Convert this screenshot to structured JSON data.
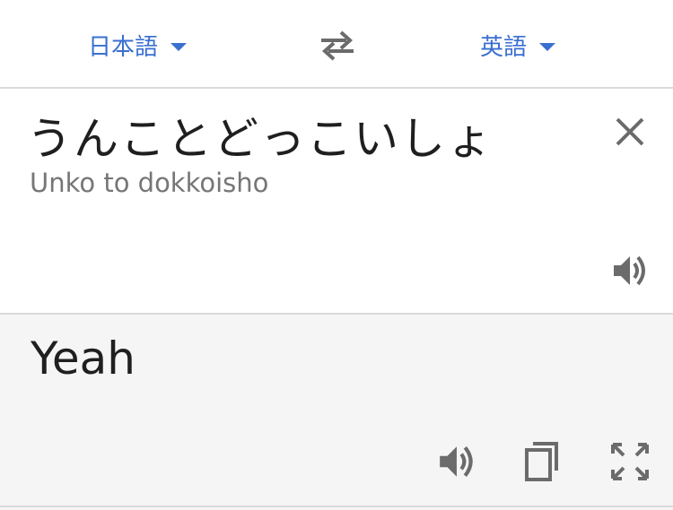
{
  "language_bar": {
    "source_language": "日本語",
    "target_language": "英語",
    "swap_icon": "swap-arrows-icon",
    "dropdown_icon": "caret-down-icon",
    "accent_color": "#3a6fd0"
  },
  "input": {
    "source_text": "うんことどっこいしょ",
    "romanization": "Unko to dokkoisho",
    "clear_icon": "close-icon",
    "speak_icon": "speaker-icon"
  },
  "output": {
    "translated_text": "Yeah",
    "speak_icon": "speaker-icon",
    "copy_icon": "copy-icon",
    "fullscreen_icon": "fullscreen-icon"
  }
}
